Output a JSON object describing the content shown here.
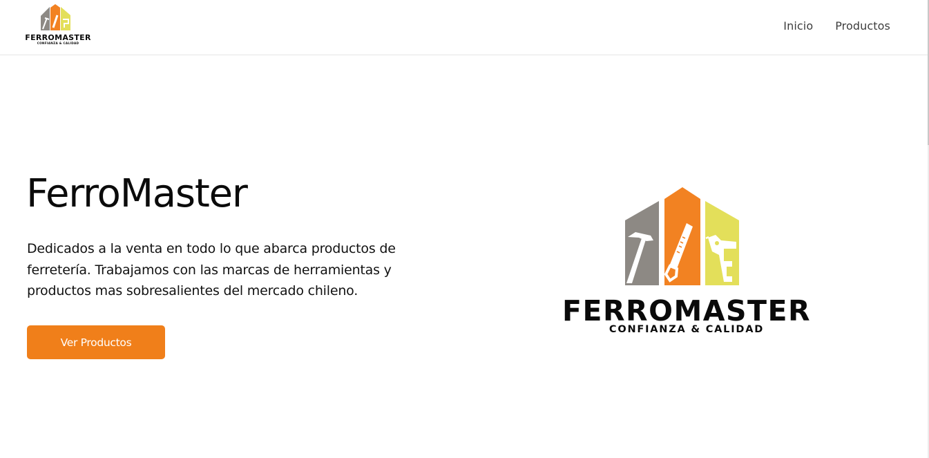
{
  "header": {
    "logo": {
      "name": "FERROMASTER",
      "tagline": "CONFIANZA & CALIDAD"
    },
    "nav": [
      {
        "label": "Inicio"
      },
      {
        "label": "Productos"
      }
    ]
  },
  "hero": {
    "title": "FerroMaster",
    "description": "Dedicados a la venta en todo lo que abarca productos de ferretería. Trabajamos con las marcas de herramientas y productos mas sobresalientes del mercado chileno.",
    "button_label": "Ver Productos",
    "logo": {
      "name": "FERROMASTER",
      "tagline": "CONFIANZA & CALIDAD"
    }
  },
  "colors": {
    "accent": "#f07f1a",
    "logo_gray": "#8d8984",
    "logo_orange": "#f28222",
    "logo_yellow": "#e3df5a"
  }
}
